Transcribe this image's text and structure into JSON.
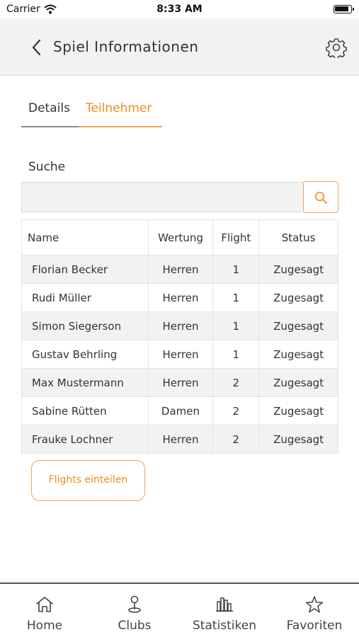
{
  "status_bar": {
    "carrier": "Carrier",
    "time": "8:33 AM"
  },
  "header": {
    "title": "Spiel Informationen"
  },
  "tabs": [
    {
      "label": "Details",
      "active": false
    },
    {
      "label": "Teilnehmer",
      "active": true
    }
  ],
  "search": {
    "label": "Suche",
    "value": "",
    "placeholder": ""
  },
  "table": {
    "columns": [
      "Name",
      "Wertung",
      "Flight",
      "Status"
    ],
    "rows": [
      [
        "Florian Becker",
        "Herren",
        "1",
        "Zugesagt"
      ],
      [
        "Rudi Müller",
        "Herren",
        "1",
        "Zugesagt"
      ],
      [
        "Simon Siegerson",
        "Herren",
        "1",
        "Zugesagt"
      ],
      [
        "Gustav Behrling",
        "Herren",
        "1",
        "Zugesagt"
      ],
      [
        "Max Mustermann",
        "Herren",
        "2",
        "Zugesagt"
      ],
      [
        "Sabine Rütten",
        "Damen",
        "2",
        "Zugesagt"
      ],
      [
        "Frauke Lochner",
        "Herren",
        "2",
        "Zugesagt"
      ]
    ]
  },
  "actions": {
    "flights_button": "Flights einteilen"
  },
  "tab_bar": {
    "items": [
      {
        "label": "Home",
        "icon": "home-icon"
      },
      {
        "label": "Clubs",
        "icon": "pin-icon"
      },
      {
        "label": "Statistiken",
        "icon": "bar-chart-icon"
      },
      {
        "label": "Favoriten",
        "icon": "star-icon"
      }
    ]
  },
  "colors": {
    "accent": "#f08c1e",
    "header_bg": "#f2f2f2",
    "row_alt": "#f2f2f2"
  }
}
